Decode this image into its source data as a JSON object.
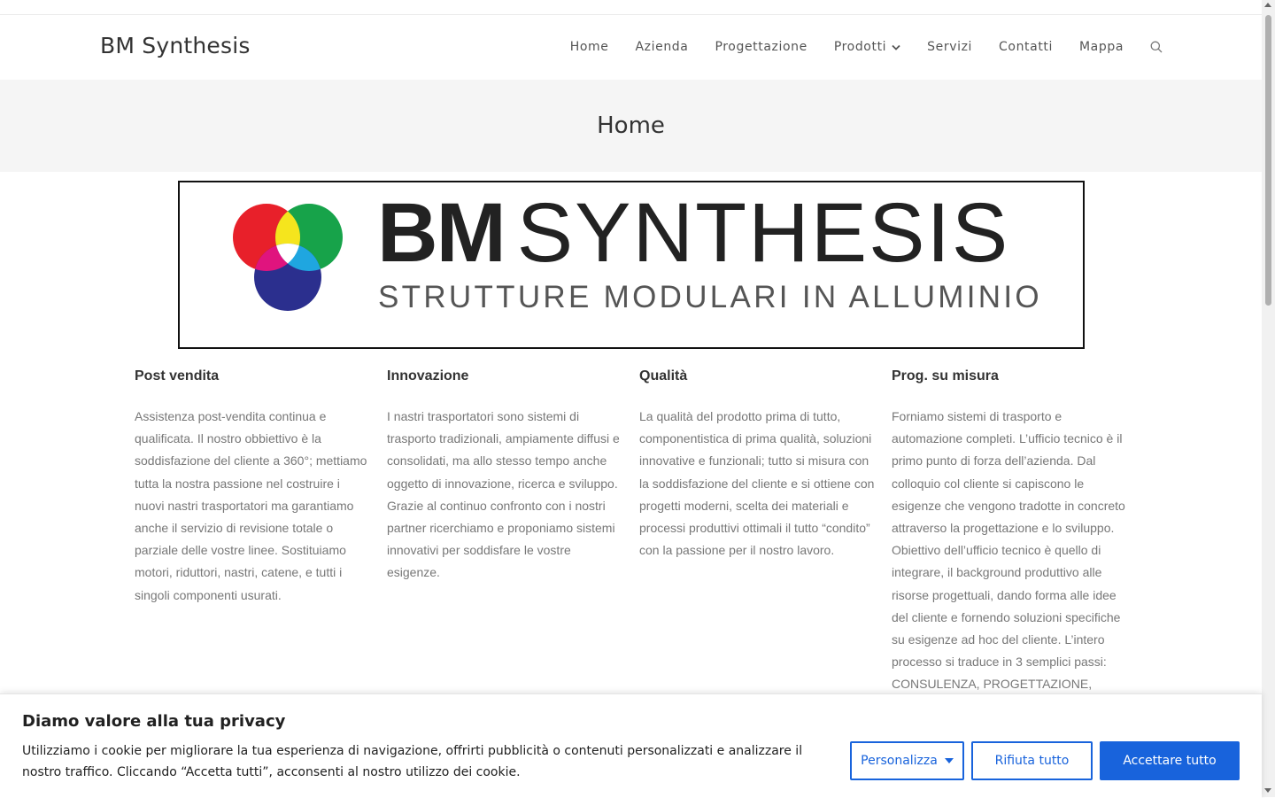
{
  "header": {
    "site_title": "BM Synthesis",
    "nav": [
      "Home",
      "Azienda",
      "Progettazione",
      "Prodotti",
      "Servizi",
      "Contatti",
      "Mappa"
    ]
  },
  "hero": {
    "title": "Home"
  },
  "logo": {
    "brand_bold": "BM",
    "brand_light": "SYNTHESIS",
    "tagline": "STRUTTURE MODULARI IN ALLUMINIO",
    "circle_colors": [
      "#e8202a",
      "#17a34a",
      "#2b2f8e"
    ]
  },
  "features": [
    {
      "title": "Post vendita",
      "text": "Assistenza post-vendita continua e qualificata. Il nostro obbiettivo è la soddisfazione del cliente a 360°; mettiamo tutta la nostra passione nel costruire i nuovi nastri trasportatori ma garantiamo anche il servizio di revisione totale o parziale delle vostre linee. Sostituiamo motori, riduttori, nastri, catene, e tutti i singoli componenti usurati."
    },
    {
      "title": "Innovazione",
      "text": "I nastri trasportatori sono sistemi di trasporto tradizionali, ampiamente diffusi e consolidati, ma allo stesso tempo anche oggetto di innovazione, ricerca e sviluppo. Grazie al continuo confronto con i nostri partner ricerchiamo e proponiamo sistemi innovativi per soddisfare le vostre esigenze."
    },
    {
      "title": "Qualità",
      "text": "La qualità del prodotto prima di tutto, componentistica di prima qualità, soluzioni innovative e funzionali; tutto si misura con la soddisfazione del cliente e si ottiene con progetti moderni, scelta dei materiali e processi produttivi ottimali il tutto “condito” con la passione per il nostro lavoro."
    },
    {
      "title": "Prog. su misura",
      "text": "Forniamo sistemi di trasporto e automazione completi. L’ufficio tecnico è il primo punto di forza dell’azienda. Dal colloquio col cliente si capiscono le esigenze che vengono tradotte in concreto attraverso la progettazione e lo sviluppo. Obiettivo dell’ufficio tecnico è quello di integrare, il background produttivo alle risorse progettuali, dando forma alle idee del cliente e fornendo soluzioni specifiche su esigenze ad hoc del cliente. L’intero processo si traduce in 3 semplici passi: CONSULENZA, PROGETTAZIONE,"
    }
  ],
  "cookie": {
    "title": "Diamo valore alla tua privacy",
    "text": "Utilizziamo i cookie per migliorare la tua esperienza di navigazione, offrirti pubblicità o contenuti personalizzati e analizzare il nostro traffico. Cliccando “Accetta tutti”, acconsenti al nostro utilizzo dei cookie.",
    "customize_label": "Personalizza",
    "reject_label": "Rifiuta tutto",
    "accept_label": "Accettare tutto",
    "accent_color": "#1863dc"
  }
}
